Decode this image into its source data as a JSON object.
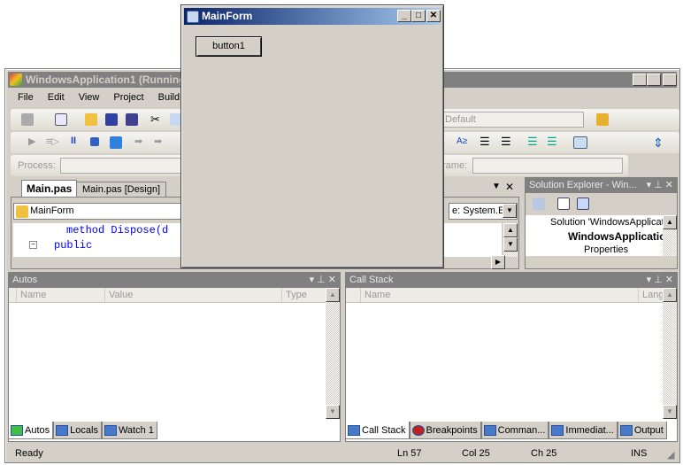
{
  "ide": {
    "title": "WindowsApplication1 (Running)",
    "menu": [
      "File",
      "Edit",
      "View",
      "Project",
      "Build"
    ],
    "config_combo": "Default",
    "process_label": "Process:",
    "frame_label": "rame:",
    "doc_tabs": [
      "Main.pas",
      "Main.pas [Design]"
    ],
    "class_combo": "MainForm",
    "member_combo": "e: System.E",
    "code_lines": [
      "method Dispose(d",
      "public"
    ],
    "solution_explorer": {
      "title": "Solution Explorer - Win...",
      "items": [
        "Solution 'WindowsApplicati",
        "WindowsApplicatio",
        "Properties"
      ]
    },
    "autos": {
      "title": "Autos",
      "columns": [
        "Name",
        "Value",
        "Type"
      ]
    },
    "callstack": {
      "title": "Call Stack",
      "columns": [
        "Name",
        "Langu"
      ]
    },
    "bottom_tabs_left": [
      "Autos",
      "Locals",
      "Watch 1"
    ],
    "bottom_tabs_right": [
      "Call Stack",
      "Breakpoints",
      "Comman...",
      "Immediat...",
      "Output"
    ],
    "status": {
      "text": "Ready",
      "ln": "Ln 57",
      "col": "Col 25",
      "ch": "Ch 25",
      "mode": "INS"
    }
  },
  "form": {
    "title": "MainForm",
    "button": "button1"
  },
  "colors": {
    "inactive_title": "#808080",
    "active_title_start": "#0a246a",
    "active_title_end": "#a6caf0",
    "face": "#d4d0c8",
    "keyword": "#0000ff"
  }
}
